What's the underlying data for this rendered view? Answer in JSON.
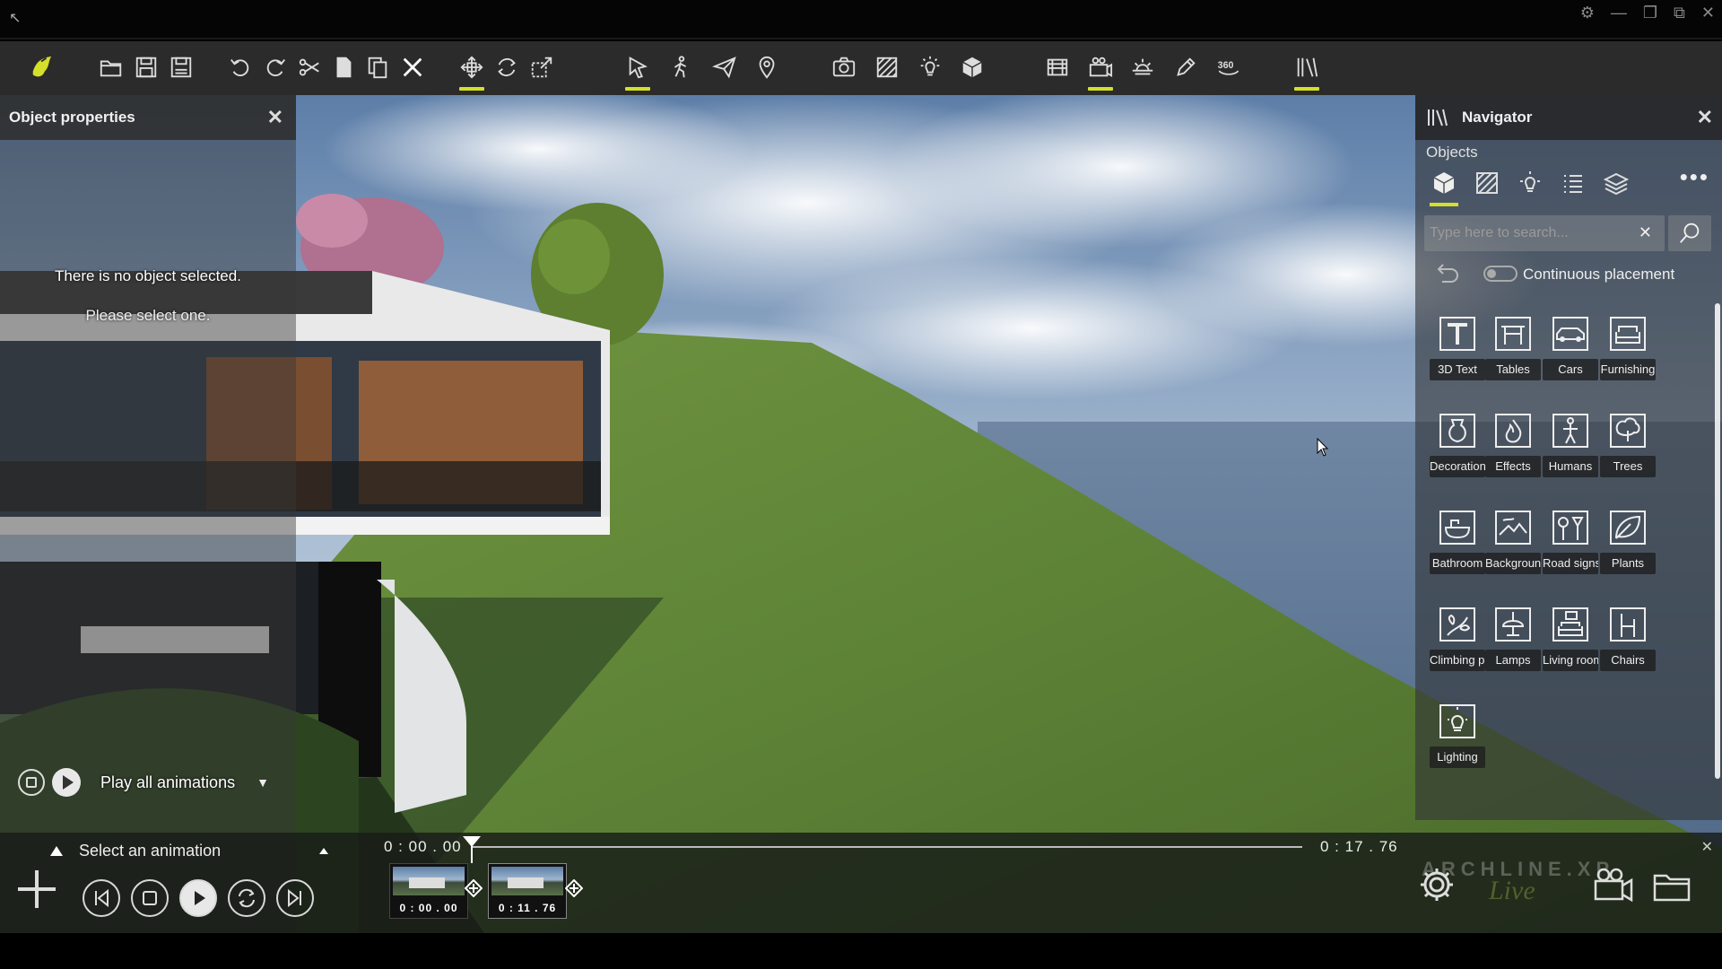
{
  "toolbar": {
    "tools": [
      {
        "name": "logo-icon"
      },
      {
        "name": "open-icon"
      },
      {
        "name": "save-icon"
      },
      {
        "name": "save-as-icon"
      },
      {
        "name": "undo-icon"
      },
      {
        "name": "redo-icon"
      },
      {
        "name": "cut-icon"
      },
      {
        "name": "copy-icon"
      },
      {
        "name": "paste-icon"
      },
      {
        "name": "delete-icon"
      },
      {
        "name": "move-icon"
      },
      {
        "name": "rotate-icon"
      },
      {
        "name": "scale-icon"
      },
      {
        "name": "select-icon"
      },
      {
        "name": "walk-icon"
      },
      {
        "name": "fly-icon"
      },
      {
        "name": "pin-icon"
      },
      {
        "name": "screenshot-icon"
      },
      {
        "name": "material-icon"
      },
      {
        "name": "light-icon"
      },
      {
        "name": "object-icon"
      },
      {
        "name": "render-icon"
      },
      {
        "name": "animation-icon"
      },
      {
        "name": "sun-icon"
      },
      {
        "name": "pen-icon"
      },
      {
        "name": "panorama-360-icon"
      },
      {
        "name": "library-icon"
      }
    ],
    "panorama_label": "360"
  },
  "object_properties": {
    "title": "Object properties",
    "empty_line1": "There is no object selected.",
    "empty_line2": "Please select one."
  },
  "navigator": {
    "title": "Navigator",
    "section": "Objects",
    "search_placeholder": "Type here to search...",
    "continuous_placement": "Continuous placement",
    "tabs": [
      "objects-tab",
      "materials-tab",
      "lights-tab",
      "list-tab",
      "layers-tab"
    ],
    "categories": [
      {
        "label": "3D Text",
        "icon": "text-3d-icon"
      },
      {
        "label": "Tables",
        "icon": "table-icon"
      },
      {
        "label": "Cars",
        "icon": "car-icon"
      },
      {
        "label": "Furnishing",
        "icon": "sofa-icon"
      },
      {
        "label": "Decoration",
        "icon": "vase-icon"
      },
      {
        "label": "Effects",
        "icon": "fire-icon"
      },
      {
        "label": "Humans",
        "icon": "human-icon"
      },
      {
        "label": "Trees",
        "icon": "tree-icon"
      },
      {
        "label": "Bathroom",
        "icon": "bathtub-icon"
      },
      {
        "label": "Background",
        "icon": "landscape-icon"
      },
      {
        "label": "Road signs",
        "icon": "road-sign-icon"
      },
      {
        "label": "Plants",
        "icon": "leaf-icon"
      },
      {
        "label": "Climbing plants",
        "icon": "climbing-plant-icon"
      },
      {
        "label": "Lamps",
        "icon": "lamp-icon"
      },
      {
        "label": "Living room",
        "icon": "living-room-icon"
      },
      {
        "label": "Chairs",
        "icon": "chair-icon"
      },
      {
        "label": "Lighting",
        "icon": "bulb-icon"
      }
    ]
  },
  "animation": {
    "play_all": "Play all animations",
    "select_label": "Select an animation",
    "time_start": "0 : 00 . 00",
    "time_end": "0 : 17 . 76",
    "keyframes": [
      {
        "time": "0 : 00 . 00"
      },
      {
        "time": "0 : 11 . 76"
      }
    ],
    "playhead_fraction": 0
  },
  "brand": {
    "name": "ARCHLINE.XP",
    "sub": "Live"
  },
  "colors": {
    "accent": "#d4e02a",
    "toolbar_bg": "#2b2b2b",
    "panel_bg": "#373737"
  }
}
